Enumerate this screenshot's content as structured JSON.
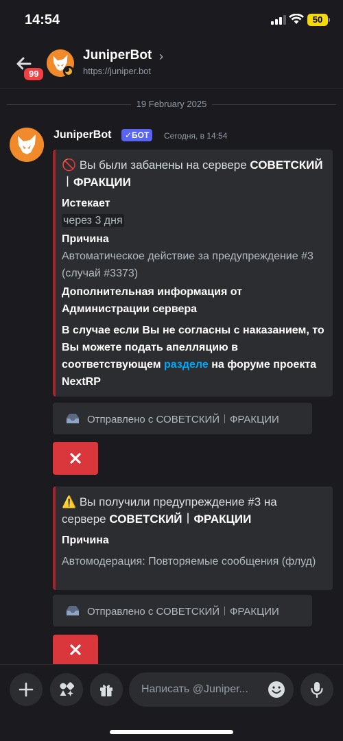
{
  "status_bar": {
    "time": "14:54",
    "battery": "50"
  },
  "header": {
    "unread_count": "99",
    "bot_name": "JuniperBot",
    "chevron": "›",
    "url": "https://juniper.bot"
  },
  "date_separator": "19 February 2025",
  "message": {
    "author": "JuniperBot",
    "bot_tag": "✓БОТ",
    "timestamp": "Сегодня, в 14:54"
  },
  "embed1": {
    "title_emoji": "🚫",
    "title_text": " Вы были забанены на сервере ",
    "server_name": "СОВЕТСКИЙ︱ФРАКЦИИ",
    "fields": [
      {
        "name": "Истекает",
        "value": "через 3 дня"
      },
      {
        "name": "Причина",
        "value": "Автоматическое действие за предупреждение #3 (случай #3373)"
      },
      {
        "name": "Дополнительная информация от Администрации сервера",
        "value_part1": "В случае если Вы не согласны с наказанием, то Вы можете подать апелляцию в соответствующем ",
        "link": "разделе",
        "value_part2": " на форуме проекта NextRP"
      }
    ]
  },
  "footer1": {
    "text": "Отправлено с СОВЕТСКИЙ︱ФРАКЦИИ"
  },
  "embed2": {
    "title_emoji": "⚠️",
    "title_text": " Вы получили предупреждение #3 на сервере ",
    "server_name": "СОВЕТСКИЙ︱ФРАКЦИИ",
    "fields": [
      {
        "name": "Причина",
        "value": "Автомодерация: Повторяемые сообщения (флуд)"
      }
    ]
  },
  "footer2": {
    "text": "Отправлено с СОВЕТСКИЙ︱ФРАКЦИИ"
  },
  "composer": {
    "placeholder": "Написать @Juniper..."
  },
  "colors": {
    "background": "#1b1b1f",
    "embed_bar": "#a4242b",
    "bot_tag": "#5865f2",
    "danger_button": "#da373c",
    "link": "#00a8fc",
    "avatar_bg": "#f08a2a"
  },
  "icons": [
    "back-arrow-icon",
    "fox-logo-icon",
    "plus-icon",
    "apps-icon",
    "gift-icon",
    "emoji-icon",
    "microphone-icon",
    "close-x-icon",
    "inbox-icon"
  ]
}
